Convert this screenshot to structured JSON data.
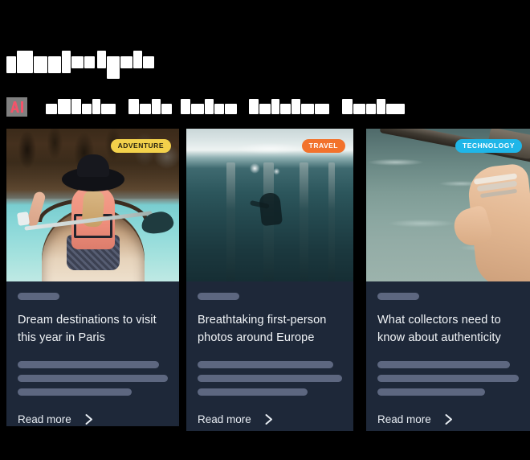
{
  "page": {
    "background_color": "#000000",
    "heading_text_redacted": true,
    "heading_label": "Popular topics"
  },
  "nav": {
    "logo": {
      "icon": "ai-logo-icon",
      "background_color": "#808080",
      "glyph_color": "#f4536a"
    },
    "tabs": [
      {
        "label": "Adventure",
        "redacted": true
      },
      {
        "label": "Travel",
        "redacted": true
      },
      {
        "label": "Nature",
        "redacted": true
      },
      {
        "label": "Technology",
        "redacted": true
      },
      {
        "label": "Reading",
        "redacted": true
      }
    ]
  },
  "cards": [
    {
      "badge": {
        "text": "ADVENTURE",
        "bg": "#f3d14b",
        "fg": "#2a2410"
      },
      "image_alt": "woman-paddling-canoe-on-turquoise-lake",
      "kicker_redacted": true,
      "title": "Dream destinations to visit this year in Paris",
      "excerpt_redacted": true,
      "read_more_label": "Read more",
      "read_more_icon": "chevron-right-icon"
    },
    {
      "badge": {
        "text": "TRAVEL",
        "bg": "#f2722c",
        "fg": "#ffffff"
      },
      "image_alt": "underwater-first-person-view-of-pier-posts",
      "kicker_redacted": true,
      "title": "Breathtaking first-person photos around Europe",
      "excerpt_redacted": true,
      "read_more_label": "Read more",
      "read_more_icon": "chevron-right-icon"
    },
    {
      "badge": {
        "text": "TECHNOLOGY",
        "bg": "#1fb6e8",
        "fg": "#ffffff"
      },
      "image_alt": "hand-with-bracelets-trailing-in-water-beside-oar",
      "kicker_redacted": true,
      "title": "What collectors need to know about authenticity",
      "excerpt_redacted": true,
      "read_more_label": "Read more",
      "read_more_icon": "chevron-right-icon"
    }
  ],
  "theme": {
    "card_background": "#1e2839",
    "skeleton_color": "#5d6780",
    "title_color": "#f2f5f8",
    "link_color": "#e8edf3"
  }
}
